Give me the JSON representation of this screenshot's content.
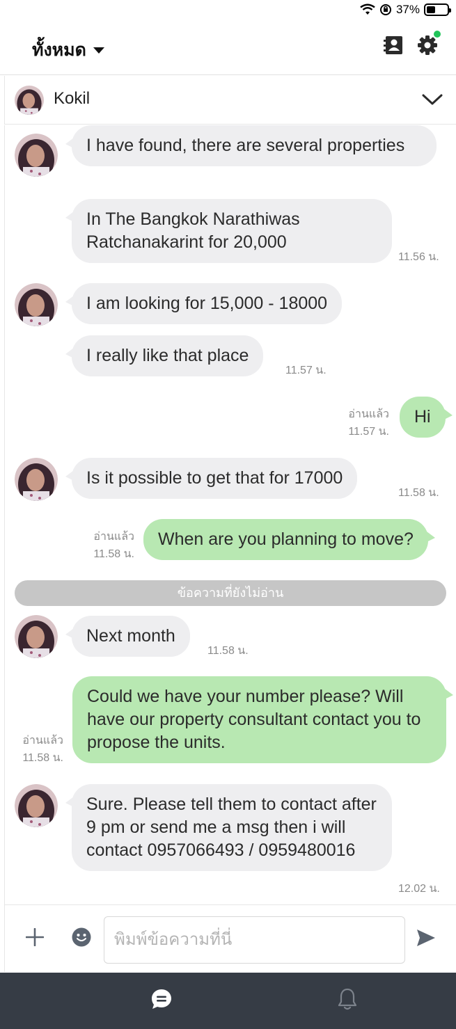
{
  "status_bar": {
    "battery": "37%",
    "battery_level": 0.37
  },
  "header": {
    "filter_label": "ทั้งหมด",
    "icons": [
      "contact-book-icon",
      "gear-icon",
      "notification-dot-icon"
    ],
    "accent_color": "#21c45a"
  },
  "chat": {
    "contact_name": "Kokil"
  },
  "messages": [
    {
      "direction": "incoming",
      "text": "I have found, there are several properties",
      "time": ""
    },
    {
      "direction": "incoming",
      "text": "In The Bangkok Narathiwas Ratchanakarint for 20,000",
      "time": "11.56 น."
    },
    {
      "direction": "incoming",
      "text": "I am looking for 15,000 - 18000",
      "time": ""
    },
    {
      "direction": "incoming",
      "text": "I really like that place",
      "time": "11.57 น."
    },
    {
      "direction": "outgoing",
      "text": "Hi",
      "read": "อ่านแล้ว",
      "time": "11.57 น."
    },
    {
      "direction": "incoming",
      "text": "Is it possible to get that for 17000",
      "time": "11.58 น."
    },
    {
      "direction": "outgoing",
      "text": "When are you planning to move?",
      "read": "อ่านแล้ว",
      "time": "11.58 น."
    },
    {
      "direction": "incoming",
      "text": "Next month",
      "time": "11.58 น."
    },
    {
      "direction": "outgoing",
      "text": "Could we have your number please? Will have our property consultant contact you to propose the units.",
      "read": "อ่านแล้ว",
      "time": "11.58 น."
    },
    {
      "direction": "incoming",
      "text": "Sure. Please tell them to contact after 9 pm or send me a msg then i will contact 0957066493 / 0959480016",
      "time": "12.02 น."
    }
  ],
  "unread_divider": "ข้อความที่ยังไม่อ่าน",
  "composer": {
    "placeholder": "พิมพ์ข้อความที่นี่"
  },
  "colors": {
    "incoming_bubble": "#eeeef0",
    "outgoing_bubble": "#b8e8b2",
    "bottom_nav": "#363c45"
  }
}
